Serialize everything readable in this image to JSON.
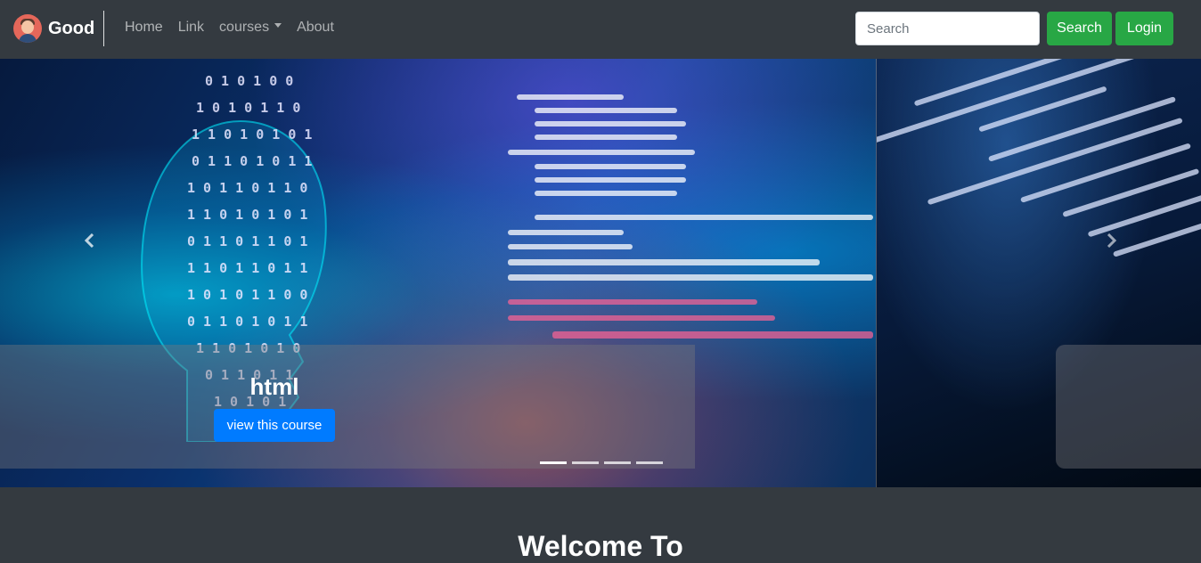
{
  "navbar": {
    "brand": "Good",
    "links": {
      "home": "Home",
      "link": "Link",
      "courses": "courses",
      "about": "About"
    },
    "search": {
      "placeholder": "Search",
      "value": ""
    },
    "search_button": "Search",
    "login_button": "Login"
  },
  "carousel": {
    "caption_title": "html",
    "caption_button": "view this course",
    "indicator_count": 4,
    "active_indicator": 1
  },
  "welcome": {
    "title": "Welcome To"
  },
  "colors": {
    "navbar_bg": "#343a40",
    "success": "#28a745",
    "primary": "#007bff"
  },
  "icons": {
    "brand": "avatar-icon",
    "prev": "chevron-left-icon",
    "next": "chevron-right-icon",
    "dropdown": "caret-down-icon"
  }
}
